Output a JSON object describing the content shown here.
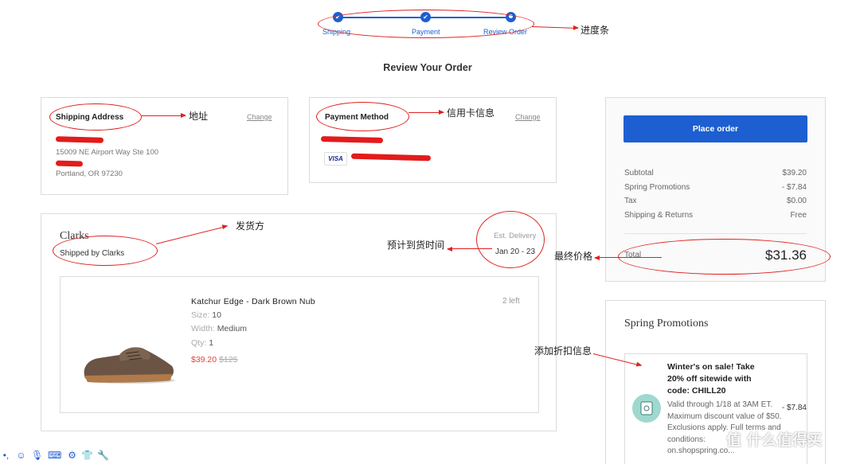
{
  "progress": {
    "steps": [
      {
        "label": "Shipping"
      },
      {
        "label": "Payment"
      },
      {
        "label": "Review Order"
      }
    ],
    "annotation": "进度条"
  },
  "page_title": "Review Your Order",
  "shipping": {
    "title": "Shipping Address",
    "change": "Change",
    "line1": "15009 NE Airport Way Ste 100",
    "line2": "Portland, OR 97230",
    "annotation": "地址"
  },
  "payment": {
    "title": "Payment Method",
    "change": "Change",
    "card_brand": "VISA",
    "annotation": "信用卡信息"
  },
  "seller": {
    "name": "Clarks",
    "shipped_by": "Shipped by Clarks",
    "annotation": "发货方",
    "est_label": "Est. Delivery",
    "est_dates": "Jan 20 - 23",
    "est_annotation": "预计到货时间"
  },
  "item": {
    "name": "Katchur Edge - Dark Brown Nub",
    "stock": "2 left",
    "size_label": "Size:",
    "size": "10",
    "width_label": "Width:",
    "width": "Medium",
    "qty_label": "Qty:",
    "qty": "1",
    "price": "$39.20",
    "original_price": "$125"
  },
  "summary": {
    "place_order": "Place order",
    "rows": [
      {
        "label": "Subtotal",
        "value": "$39.20"
      },
      {
        "label": "Spring Promotions",
        "value": "- $7.84"
      },
      {
        "label": "Tax",
        "value": "$0.00"
      },
      {
        "label": "Shipping & Returns",
        "value": "Free"
      }
    ],
    "total_label": "Total",
    "total_value": "$31.36",
    "annotation": "最终价格"
  },
  "promotions": {
    "title": "Spring Promotions",
    "annotation": "添加折扣信息",
    "headline1": "Winter's on sale! Take",
    "headline2": "20% off sitewide with",
    "headline3": "code: CHILL20",
    "d1": "Valid through 1/18 at 3AM ET.",
    "d2": "Maximum discount value of $50.",
    "d3": "Exclusions apply. Full terms and",
    "d4": "conditions:",
    "d5": "on.shopspring.co...",
    "amount": "- $7.84"
  },
  "watermark": "值 什么值得买",
  "colors": {
    "accent": "#1d5fd1",
    "price_red": "#e8413a",
    "annotation_red": "#e02020"
  }
}
